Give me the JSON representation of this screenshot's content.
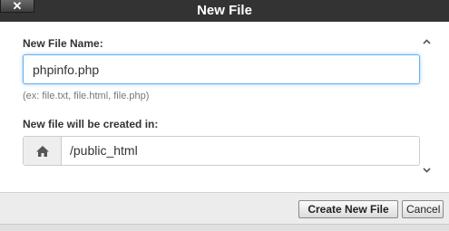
{
  "dialog": {
    "title": "New File",
    "close_icon": "close-x-icon"
  },
  "form": {
    "filename_label": "New File Name:",
    "filename_value": "phpinfo.php",
    "filename_hint": "(ex: file.txt, file.html, file.php)",
    "location_label": "New file will be created in:",
    "location_icon": "home-icon",
    "location_path": "/public_html"
  },
  "scrollbar": {
    "up_icon": "chevron-up-icon",
    "down_icon": "chevron-down-icon"
  },
  "buttons": {
    "create_label": "Create New File",
    "cancel_label": "Cancel"
  },
  "colors": {
    "titlebar_bg": "#333333",
    "input_focus_border": "#66afe9"
  }
}
